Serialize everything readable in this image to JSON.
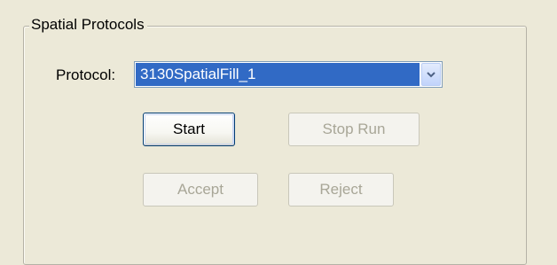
{
  "group": {
    "title": "Spatial Protocols"
  },
  "protocol": {
    "label": "Protocol:",
    "selected": "3130SpatialFill_1"
  },
  "buttons": {
    "start": "Start",
    "stop_run": "Stop Run",
    "accept": "Accept",
    "reject": "Reject"
  },
  "state": {
    "start_enabled": true,
    "stop_run_enabled": false,
    "accept_enabled": false,
    "reject_enabled": false
  },
  "colors": {
    "panel_background": "#ece9d8",
    "selection_highlight": "#316ac5",
    "combo_border": "#7f9db9",
    "disabled_text": "#a8a697"
  },
  "icons": {
    "dropdown": "chevron-down-icon"
  }
}
